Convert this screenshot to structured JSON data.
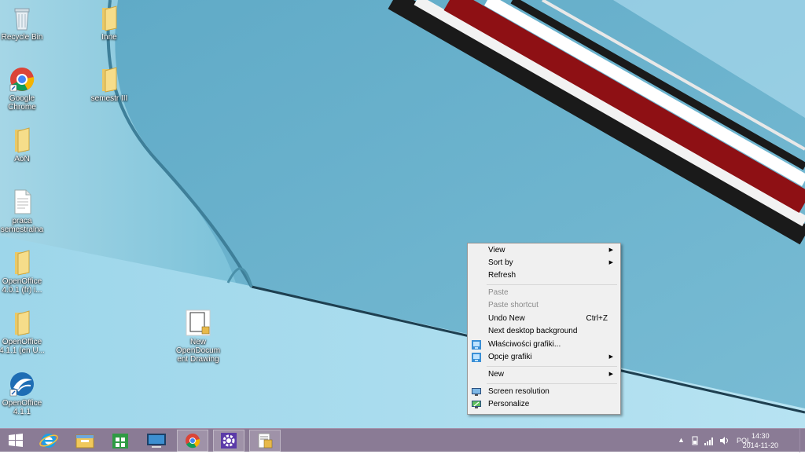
{
  "desktop_icons": [
    {
      "label": "Recycle Bin",
      "icon": "recycle-bin-icon"
    },
    {
      "label": "Inne",
      "icon": "folder-icon"
    },
    {
      "label": "Google Chrome",
      "icon": "chrome-icon"
    },
    {
      "label": "semestr III",
      "icon": "folder-icon"
    },
    {
      "label": "AoN",
      "icon": "folder-icon"
    },
    {
      "label": "praca semestralna",
      "icon": "document-icon"
    },
    {
      "label": "OpenOffice 4.0.1 (fr) i...",
      "icon": "folder-icon"
    },
    {
      "label": "OpenOffice 4.1.1 (en U...",
      "icon": "folder-icon"
    },
    {
      "label": "OpenOffice 4.1.1",
      "icon": "openoffice-icon"
    },
    {
      "label": "New OpenDocument Drawing",
      "icon": "drawing-document-icon"
    }
  ],
  "context_menu": {
    "items": [
      {
        "label": "View",
        "submenu": true
      },
      {
        "label": "Sort by",
        "submenu": true
      },
      {
        "label": "Refresh"
      },
      {
        "label": "Paste",
        "disabled": true
      },
      {
        "label": "Paste shortcut",
        "disabled": true
      },
      {
        "label": "Undo New",
        "shortcut": "Ctrl+Z"
      },
      {
        "label": "Next desktop background"
      },
      {
        "label": "Właściwości grafiki...",
        "icon": "intel-graphics-icon"
      },
      {
        "label": "Opcje grafiki",
        "icon": "intel-graphics-icon",
        "submenu": true
      },
      {
        "label": "New",
        "submenu": true
      },
      {
        "label": "Screen resolution",
        "icon": "monitor-icon"
      },
      {
        "label": "Personalize",
        "icon": "personalize-icon"
      }
    ]
  },
  "taskbar": {
    "buttons": [
      "start-button",
      "internet-explorer",
      "file-explorer",
      "store",
      "remote-desktop",
      "google-chrome",
      "settings-app",
      "openoffice-draw"
    ],
    "tray": {
      "language": "POL",
      "time": "14:30",
      "date": "2014-11-20"
    }
  },
  "colors": {
    "taskbar": "#8a7b95",
    "menu_bg": "#f0f0f0",
    "wallpaper_blue": "#6fb6cf",
    "stripe_red": "#8e1014"
  }
}
